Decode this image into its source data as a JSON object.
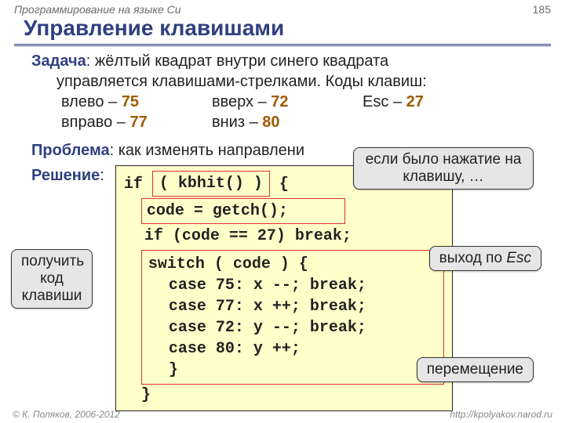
{
  "header": {
    "course": "Программирование на языке Си",
    "page_number": "185"
  },
  "title": "Управление клавишами",
  "task": {
    "label": "Задача",
    "text_line1": ": жёлтый квадрат внутри синего квадрата",
    "text_line2": "управляется клавишами-стрелками. Коды клавиш:"
  },
  "keys": {
    "left_label": "влево – ",
    "left_code": "75",
    "right_label": "вправо – ",
    "right_code": "77",
    "up_label": "вверх – ",
    "up_code": "72",
    "down_label": "вниз – ",
    "down_code": "80",
    "esc_label": "Esc – ",
    "esc_code": "27"
  },
  "problem": {
    "label": "Проблема",
    "text": ": как изменять направлени"
  },
  "solution": {
    "label": "Решение",
    "colon": ":"
  },
  "code": {
    "if_kw": "if",
    "kbhit": "( kbhit() )",
    "brace_open": "{",
    "getch_line": "code = getch();",
    "esc_line": "if (code == 27) break;",
    "switch_line": "switch ( code ) {",
    "case75": "case 75: x --; break;",
    "case77": "case 77: x ++; break;",
    "case72": "case 72: y --; break;",
    "case80": "case 80: y ++;",
    "brace_close_inner": "}",
    "brace_close_outer": "}"
  },
  "callouts": {
    "kbhit": "если было нажатие на клавишу, …",
    "getch": "получить код клавиши",
    "esc": "выход по ",
    "esc_word": "Esc",
    "move": "перемещение"
  },
  "footer": {
    "copyright": "© К. Поляков, 2006-2012",
    "url": "http://kpolyakov.narod.ru"
  }
}
